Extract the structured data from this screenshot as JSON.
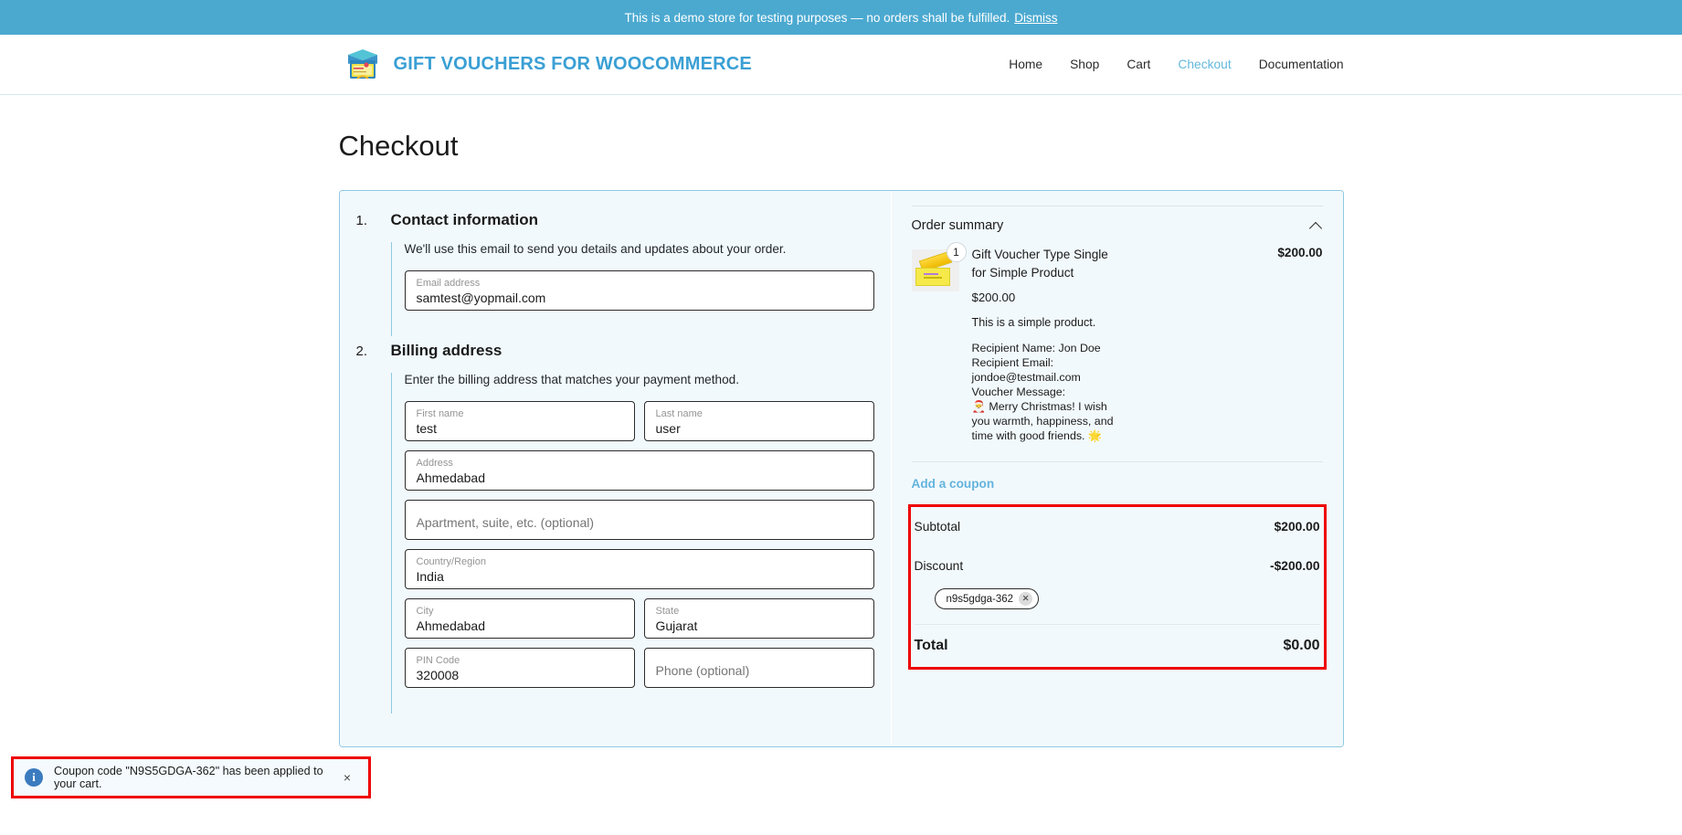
{
  "demo_banner": {
    "message": "This is a demo store for testing purposes — no orders shall be fulfilled.",
    "dismiss_label": "Dismiss"
  },
  "header": {
    "brand_name": "GIFT VOUCHERS FOR WOOCOMMERCE",
    "logo_icon": "gift-box-voucher-icon",
    "nav": [
      {
        "label": "Home",
        "current": false
      },
      {
        "label": "Shop",
        "current": false
      },
      {
        "label": "Cart",
        "current": false
      },
      {
        "label": "Checkout",
        "current": true
      },
      {
        "label": "Documentation",
        "current": false
      }
    ]
  },
  "page": {
    "title": "Checkout"
  },
  "checkout": {
    "steps": [
      {
        "number": "1.",
        "title": "Contact information",
        "description": "We'll use this email to send you details and updates about your order."
      },
      {
        "number": "2.",
        "title": "Billing address",
        "description": "Enter the billing address that matches your payment method."
      }
    ],
    "contact": {
      "email": {
        "label": "Email address",
        "value": "samtest@yopmail.com"
      }
    },
    "billing": {
      "first_name": {
        "label": "First name",
        "value": "test"
      },
      "last_name": {
        "label": "Last name",
        "value": "user"
      },
      "address": {
        "label": "Address",
        "value": "Ahmedabad"
      },
      "apartment": {
        "placeholder": "Apartment, suite, etc. (optional)",
        "value": ""
      },
      "country": {
        "label": "Country/Region",
        "value": "India"
      },
      "city": {
        "label": "City",
        "value": "Ahmedabad"
      },
      "state": {
        "label": "State",
        "value": "Gujarat"
      },
      "pin_code": {
        "label": "PIN Code",
        "value": "320008"
      },
      "phone": {
        "placeholder": "Phone (optional)",
        "value": ""
      }
    }
  },
  "order_summary": {
    "title": "Order summary",
    "collapse_icon": "chevron-up-icon",
    "item": {
      "thumbnail_icon": "gift-voucher-ticket-image",
      "quantity": "1",
      "name": "Gift Voucher Type Single for Simple Product",
      "price": "$200.00",
      "unit_price": "$200.00",
      "description": "This is a simple product.",
      "recipient_name_line": "Recipient Name: Jon Doe",
      "recipient_email_label": "Recipient Email:",
      "recipient_email": "jondoe@testmail.com",
      "voucher_message_label": "Voucher Message:",
      "voucher_message": "🎅 Merry Christmas! I wish you warmth, happiness, and time with good friends. 🌟"
    },
    "add_coupon_label": "Add a coupon",
    "totals": {
      "subtotal_label": "Subtotal",
      "subtotal_value": "$200.00",
      "discount_label": "Discount",
      "discount_value": "-$200.00",
      "coupon_chip": "n9s5gdga-362",
      "total_label": "Total",
      "total_value": "$0.00"
    }
  },
  "toast": {
    "icon": "info-icon",
    "message": "Coupon code \"N9S5GDGA-362\" has been applied to your cart.",
    "close_label": "×"
  },
  "colors": {
    "brand_blue": "#3a9fd4",
    "banner_blue": "#4ba9d0",
    "panel_bg": "#f2f9fc",
    "highlight_red": "#ef0000",
    "link_blue": "#64b4dd"
  }
}
